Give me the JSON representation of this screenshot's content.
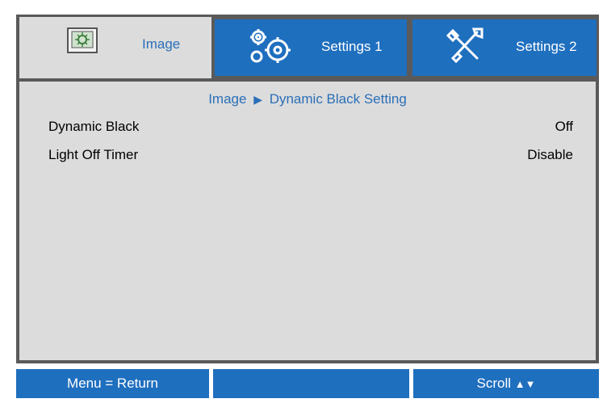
{
  "tabs": [
    {
      "label": "Image",
      "icon": "image-icon",
      "active": true
    },
    {
      "label": "Settings 1",
      "icon": "gears-icon",
      "active": false
    },
    {
      "label": "Settings 2",
      "icon": "tools-icon",
      "active": false
    }
  ],
  "breadcrumb": {
    "section": "Image",
    "page": "Dynamic Black Setting"
  },
  "settings": [
    {
      "label": "Dynamic Black",
      "value": "Off"
    },
    {
      "label": "Light Off Timer",
      "value": "Disable"
    }
  ],
  "footer": {
    "menu_hint": "Menu = Return",
    "middle": "",
    "scroll_hint": "Scroll"
  },
  "colors": {
    "accent": "#1f6fbf",
    "panel": "#dcdcdc",
    "frame": "#5a5a5a",
    "highlight_text": "#2a6fb8"
  }
}
